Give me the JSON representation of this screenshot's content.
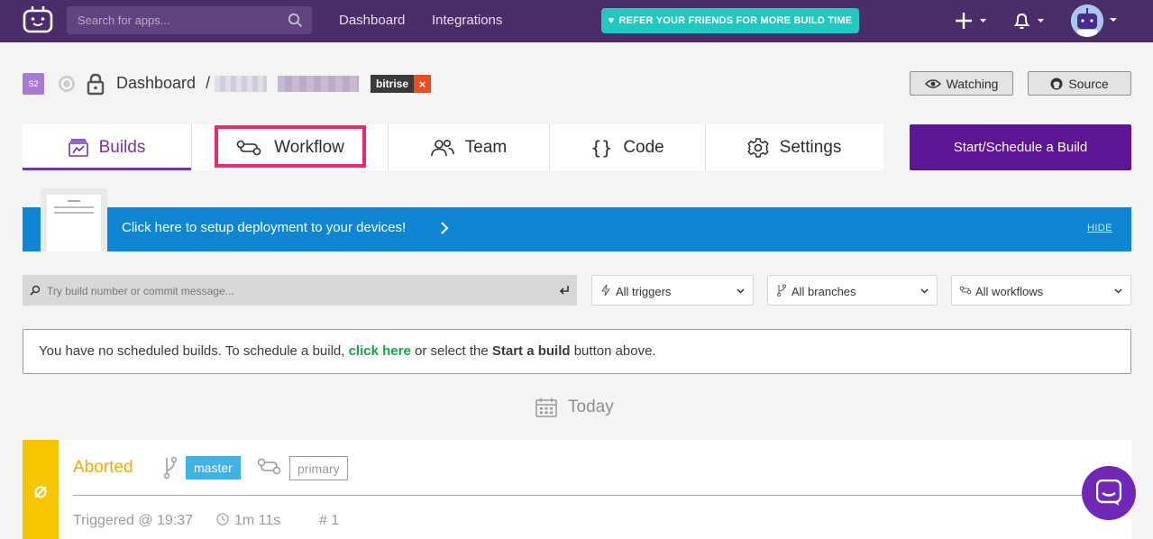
{
  "topnav": {
    "search_placeholder": "Search for apps...",
    "links": [
      "Dashboard",
      "Integrations"
    ],
    "refer_prefix": "REFER YOUR FRIENDS FOR",
    "refer_strong": "MORE BUILD TIME"
  },
  "breadcrumb": {
    "app_initials": "S2",
    "root": "Dashboard",
    "separator": "/",
    "tag_name": "bitrise",
    "tag_close": "×"
  },
  "actions": {
    "watching": "Watching",
    "source": "Source",
    "start": "Start/Schedule a Build"
  },
  "tabs": [
    {
      "label": "Builds",
      "active": true
    },
    {
      "label": "Workflow"
    },
    {
      "label": "Team"
    },
    {
      "label": "Code"
    },
    {
      "label": "Settings"
    }
  ],
  "code_tab_glyph": "{}",
  "banner": {
    "text": "Click here to setup deployment to your devices!",
    "hide": "HIDE"
  },
  "filters": {
    "search_placeholder": "Try build number or commit message...",
    "triggers": "All triggers",
    "branches": "All branches",
    "workflows": "All workflows"
  },
  "notice": {
    "before": "You have no scheduled builds. To schedule a build, ",
    "link": "click here",
    "middle": " or select the ",
    "strong": "Start a build",
    "after": " button above."
  },
  "today": "Today",
  "build": {
    "status": "Aborted",
    "branch": "master",
    "workflow": "primary",
    "triggered": "Triggered @ 19:37",
    "duration": "1m 11s",
    "number": "# 1"
  },
  "colors": {
    "nav": "#4b2d6a",
    "accent": "#6e35b3",
    "start_button": "#5c1694",
    "banner": "#0f86d2",
    "refer": "#22c8be",
    "aborted": "#f2ac00",
    "highlight": "#ee2a68"
  }
}
